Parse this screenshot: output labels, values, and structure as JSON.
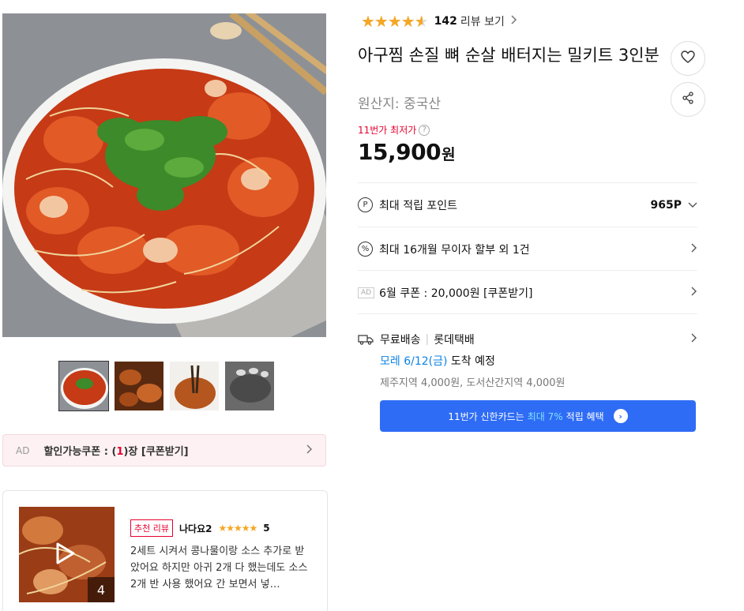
{
  "gallery": {
    "thumb_count": 4,
    "active_index": 0
  },
  "coupon_bar": {
    "ad": "AD",
    "prefix": "할인가능쿠폰 : (",
    "count": "1",
    "suffix": ")장 [쿠폰받기]"
  },
  "review": {
    "media_count": "4",
    "badge": "추천 리뷰",
    "reviewer": "나다요2",
    "stars": "★★★★★",
    "score": "5",
    "text": "2세트 시켜서 콩나물이랑 소스 추가로 받았어요 하지만 아귀 2개 다 했는데도 소스 2개 반 사용 했어요 간 보면서 넣…"
  },
  "rating": {
    "value": 4.6,
    "stars": "★★★★★",
    "count": "142",
    "label": "리뷰 보기"
  },
  "product": {
    "title": "아구찜 손질 뼈 순살 배터지는 밀키트 3인분",
    "origin": "원산지:  중국산",
    "lowest_label": "11번가 최저가",
    "price": "15,900",
    "price_unit": "원"
  },
  "rows": {
    "points_label": "최대 적립 포인트",
    "points_value": "965P",
    "installment_label": "최대 16개월 무이자 할부 외 1건",
    "coupon_ad": "AD",
    "coupon_label": "6월 쿠폰 : 20,000원 [쿠폰받기]"
  },
  "delivery": {
    "type": "무료배송",
    "carrier": "롯데택배",
    "date": "모레 6/12(금)",
    "arrive_suffix": " 도착 예정",
    "extra": "제주지역 4,000원, 도서산간지역 4,000원"
  },
  "card_benefit": {
    "prefix": "11번가 신한카드는",
    "highlight": "최대 7%",
    "suffix": "적립 혜택"
  },
  "colors": {
    "accent_red": "#e8002d",
    "star": "#f5a623",
    "blue": "#2f6cf5",
    "date_blue": "#0b83e6"
  }
}
